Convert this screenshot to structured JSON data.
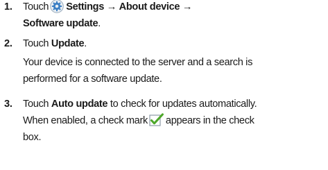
{
  "steps": [
    {
      "number": "1.",
      "prefix": "Touch",
      "icon": "settings-gear-icon",
      "path_1": "Settings",
      "arrow_1": "→",
      "path_2": "About device",
      "arrow_2": "→",
      "path_3": "Software update",
      "path_end": "."
    },
    {
      "number": "2.",
      "prefix": "Touch",
      "action": "Update",
      "action_end": ".",
      "desc_line_1": "Your device is connected to the server and a search is",
      "desc_line_2": "performed for a software update."
    },
    {
      "number": "3.",
      "prefix": "Touch",
      "action": "Auto update",
      "suffix": "to check for updates automatically.",
      "line_2_start": "When enabled, a check mark",
      "icon": "checkbox-checked-icon",
      "line_2_end": "appears in the check",
      "line_3": "box."
    }
  ],
  "colors": {
    "text": "#1a1a1a",
    "checkmark": "#4ea82a",
    "gear_blue": "#3b7fc4"
  }
}
